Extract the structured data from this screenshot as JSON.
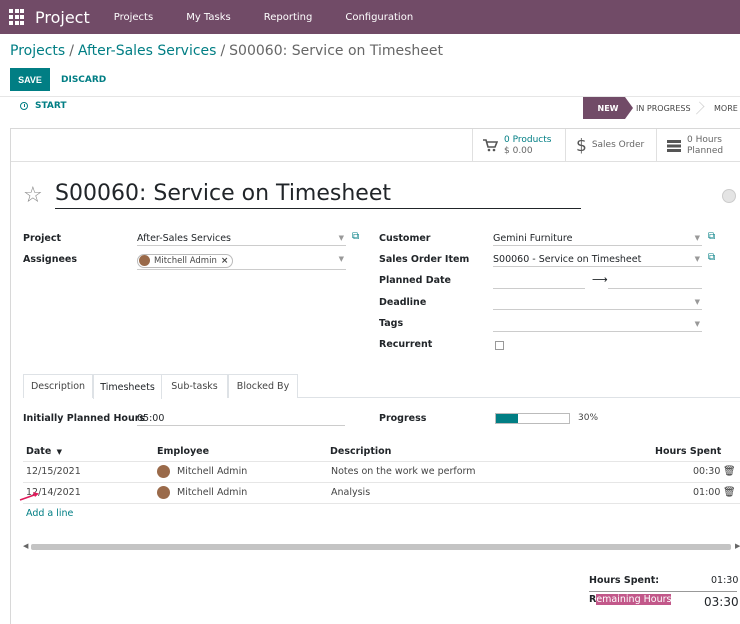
{
  "navbar": {
    "app_name": "Project",
    "menu": [
      "Projects",
      "My Tasks",
      "Reporting",
      "Configuration"
    ]
  },
  "breadcrumb": {
    "items": [
      "Projects",
      "After-Sales Services"
    ],
    "current": "S00060: Service on Timesheet",
    "separator": "/"
  },
  "actions": {
    "save": "SAVE",
    "discard": "DISCARD"
  },
  "statusbar": {
    "start": "START",
    "stages": [
      "NEW",
      "IN PROGRESS",
      "MORE"
    ],
    "active_stage": "NEW"
  },
  "smart_buttons": {
    "products_count": "0 Products",
    "products_amount": "$ 0.00",
    "sales_order": "Sales Order",
    "hours_count": "0  Hours",
    "hours_label": "Planned"
  },
  "task": {
    "title": "S00060: Service on Timesheet",
    "fields_left": {
      "project_label": "Project",
      "project_value": "After-Sales Services",
      "assignees_label": "Assignees",
      "assignee_tag": "Mitchell Admin"
    },
    "fields_right": {
      "customer_label": "Customer",
      "customer_value": "Gemini Furniture",
      "sol_label": "Sales Order Item",
      "sol_value": "S00060 - Service on Timesheet",
      "planned_date_label": "Planned Date",
      "deadline_label": "Deadline",
      "tags_label": "Tags",
      "recurrent_label": "Recurrent",
      "recurrent_checked": false
    }
  },
  "tabs": [
    "Description",
    "Timesheets",
    "Sub-tasks",
    "Blocked By"
  ],
  "active_tab": "Timesheets",
  "timesheets": {
    "planned_label": "Initially Planned Hours",
    "planned_value": "05:00",
    "progress_label": "Progress",
    "progress_value": "30%",
    "progress_fraction": 0.3,
    "columns": [
      "Date",
      "Employee",
      "Description",
      "Hours Spent"
    ],
    "rows": [
      {
        "date": "12/15/2021",
        "employee": "Mitchell Admin",
        "description": "Notes on the work we perform",
        "hours": "00:30"
      },
      {
        "date": "12/14/2021",
        "employee": "Mitchell Admin",
        "description": "Analysis",
        "hours": "01:00"
      }
    ],
    "add_line": "Add a line",
    "totals": {
      "spent_label": "Hours Spent:",
      "spent_value": "01:30",
      "remaining_first": "R",
      "remaining_rest": "emaining Hours",
      "remaining_value": "03:30"
    }
  },
  "colors": {
    "brand": "#714b67",
    "accent": "#017e84",
    "highlight": "#c2588a"
  },
  "icons": [
    "apps-grid-icon",
    "clock-icon",
    "cart-icon",
    "dollar-icon",
    "timesheet-icon",
    "star-icon",
    "external-link-icon",
    "trash-icon",
    "sort-caret-icon",
    "arrow-right-icon"
  ]
}
